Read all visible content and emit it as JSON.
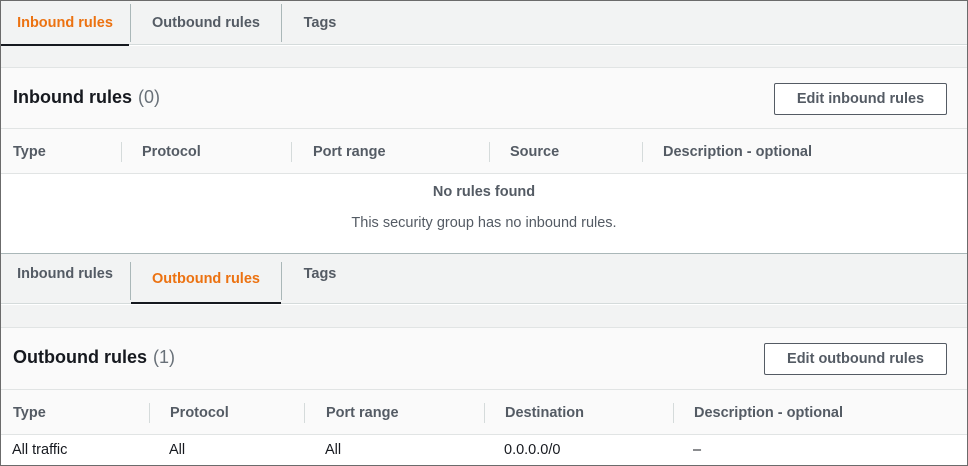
{
  "inbound_view": {
    "tabs": [
      {
        "label": "Inbound rules",
        "active": true
      },
      {
        "label": "Outbound rules",
        "active": false
      },
      {
        "label": "Tags",
        "active": false
      }
    ],
    "title": "Inbound rules",
    "count": "(0)",
    "edit_button": "Edit inbound rules",
    "columns": [
      "Type",
      "Protocol",
      "Port range",
      "Source",
      "Description - optional"
    ],
    "empty_title": "No rules found",
    "empty_message": "This security group has no inbound rules."
  },
  "outbound_view": {
    "tabs": [
      {
        "label": "Inbound rules",
        "active": false
      },
      {
        "label": "Outbound rules",
        "active": true
      },
      {
        "label": "Tags",
        "active": false
      }
    ],
    "title": "Outbound rules",
    "count": "(1)",
    "edit_button": "Edit outbound rules",
    "columns": [
      "Type",
      "Protocol",
      "Port range",
      "Destination",
      "Description - optional"
    ],
    "rows": [
      [
        "All traffic",
        "All",
        "All",
        "0.0.0.0/0",
        "–"
      ]
    ]
  },
  "colors": {
    "accent": "#ec7211",
    "text": "#16191f",
    "muted": "#545b64"
  }
}
